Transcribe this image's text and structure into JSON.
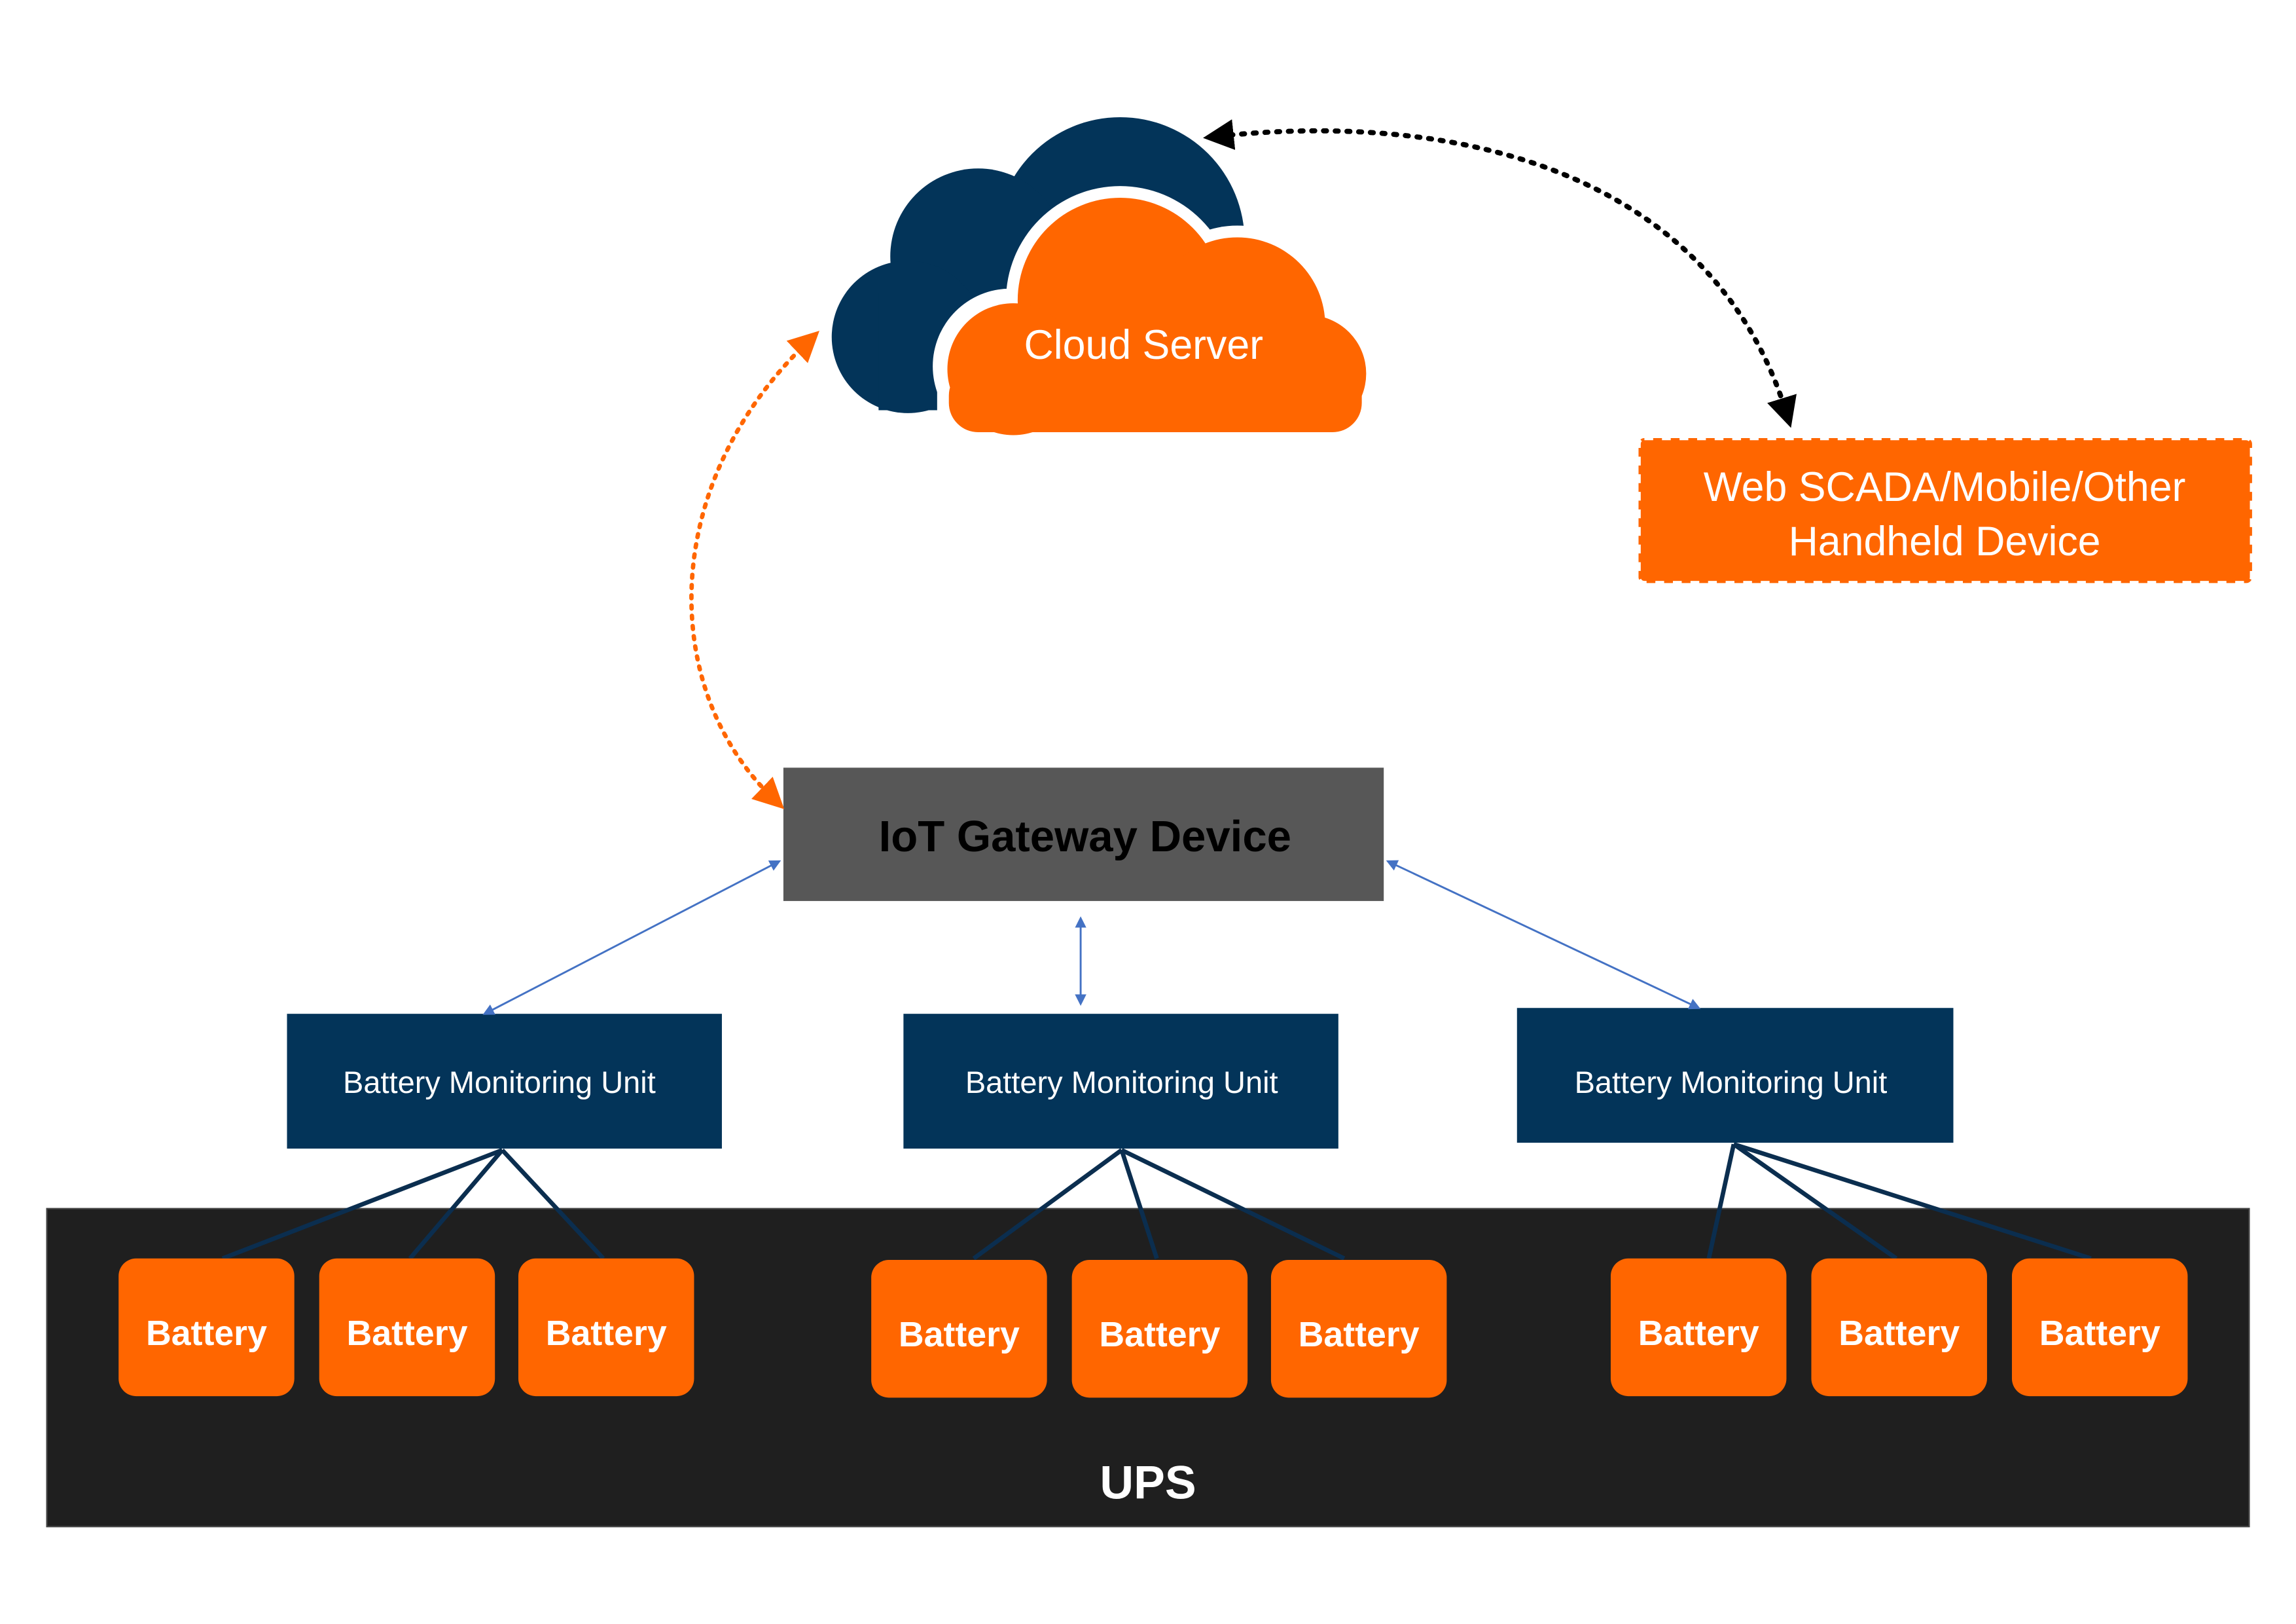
{
  "colors": {
    "orange": "#FF6600",
    "navy": "#033459",
    "gateway_gray": "#575757",
    "ups_black": "#1F1F1F",
    "link_blue": "#4472C4",
    "dotted_black": "#000000"
  },
  "cloud": {
    "label": "Cloud Server",
    "icon": "cloud-icon"
  },
  "client_device": {
    "line1": "Web SCADA/Mobile/Other",
    "line2": "Handheld Device"
  },
  "gateway": {
    "label": "IoT Gateway Device"
  },
  "bmus": [
    {
      "label": "Battery Monitoring Unit"
    },
    {
      "label": "Battery Monitoring Unit"
    },
    {
      "label": "Battery Monitoring Unit"
    }
  ],
  "batteries": [
    [
      "Battery",
      "Battery",
      "Battery"
    ],
    [
      "Battery",
      "Battery",
      "Battery"
    ],
    [
      "Battery",
      "Battery",
      "Battery"
    ]
  ],
  "ups": {
    "label": "UPS"
  }
}
